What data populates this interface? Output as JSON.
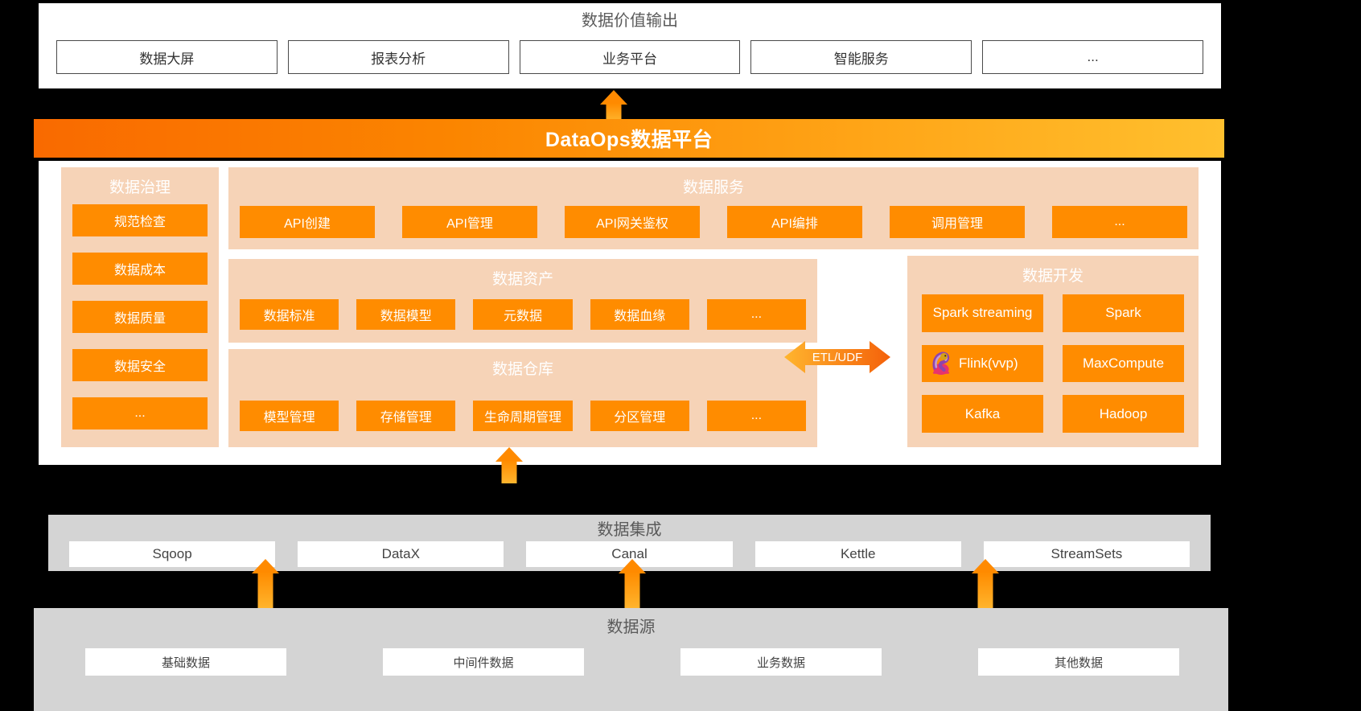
{
  "value_output": {
    "title": "数据价值输出",
    "items": [
      {
        "label": "数据大屏"
      },
      {
        "label": "报表分析"
      },
      {
        "label": "业务平台"
      },
      {
        "label": "智能服务"
      },
      {
        "label": "..."
      }
    ]
  },
  "platform_banner": {
    "label": "DataOps数据平台"
  },
  "governance": {
    "title": "数据治理",
    "items": [
      {
        "label": "规范检查"
      },
      {
        "label": "数据成本"
      },
      {
        "label": "数据质量"
      },
      {
        "label": "数据安全"
      },
      {
        "label": "..."
      }
    ]
  },
  "data_service": {
    "title": "数据服务",
    "items": [
      {
        "label": "API创建"
      },
      {
        "label": "API管理"
      },
      {
        "label": "API网关鉴权"
      },
      {
        "label": "API编排"
      },
      {
        "label": "调用管理"
      },
      {
        "label": "..."
      }
    ]
  },
  "data_assets": {
    "title": "数据资产",
    "items": [
      {
        "label": "数据标准"
      },
      {
        "label": "数据模型"
      },
      {
        "label": "元数据"
      },
      {
        "label": "数据血缘"
      },
      {
        "label": "..."
      }
    ]
  },
  "data_warehouse": {
    "title": "数据仓库",
    "items": [
      {
        "label": "模型管理"
      },
      {
        "label": "存储管理"
      },
      {
        "label": "生命周期管理"
      },
      {
        "label": "分区管理"
      },
      {
        "label": "..."
      }
    ]
  },
  "data_development": {
    "title": "数据开发",
    "items": [
      {
        "label": "Spark streaming",
        "icon": ""
      },
      {
        "label": "Spark",
        "icon": ""
      },
      {
        "label": "Flink(vvp)",
        "icon": "flink-squirrel-icon"
      },
      {
        "label": "MaxCompute",
        "icon": ""
      },
      {
        "label": "Kafka",
        "icon": ""
      },
      {
        "label": "Hadoop",
        "icon": ""
      }
    ]
  },
  "etl_connector": {
    "label": "ETL/UDF"
  },
  "data_integration": {
    "title": "数据集成",
    "items": [
      {
        "label": "Sqoop"
      },
      {
        "label": "DataX"
      },
      {
        "label": "Canal"
      },
      {
        "label": "Kettle"
      },
      {
        "label": "StreamSets"
      }
    ]
  },
  "data_source": {
    "title": "数据源",
    "items": [
      {
        "label": "基础数据"
      },
      {
        "label": "中间件数据"
      },
      {
        "label": "业务数据"
      },
      {
        "label": "其他数据"
      }
    ]
  },
  "colors": {
    "accent_orange": "#ff8c00",
    "banner_gradient_start": "#f96a00",
    "banner_gradient_end": "#ffc02e",
    "group_peach": "#f6d3b7",
    "panel_gray": "#d4d4d4",
    "arrow_orange": "#ffa500"
  }
}
